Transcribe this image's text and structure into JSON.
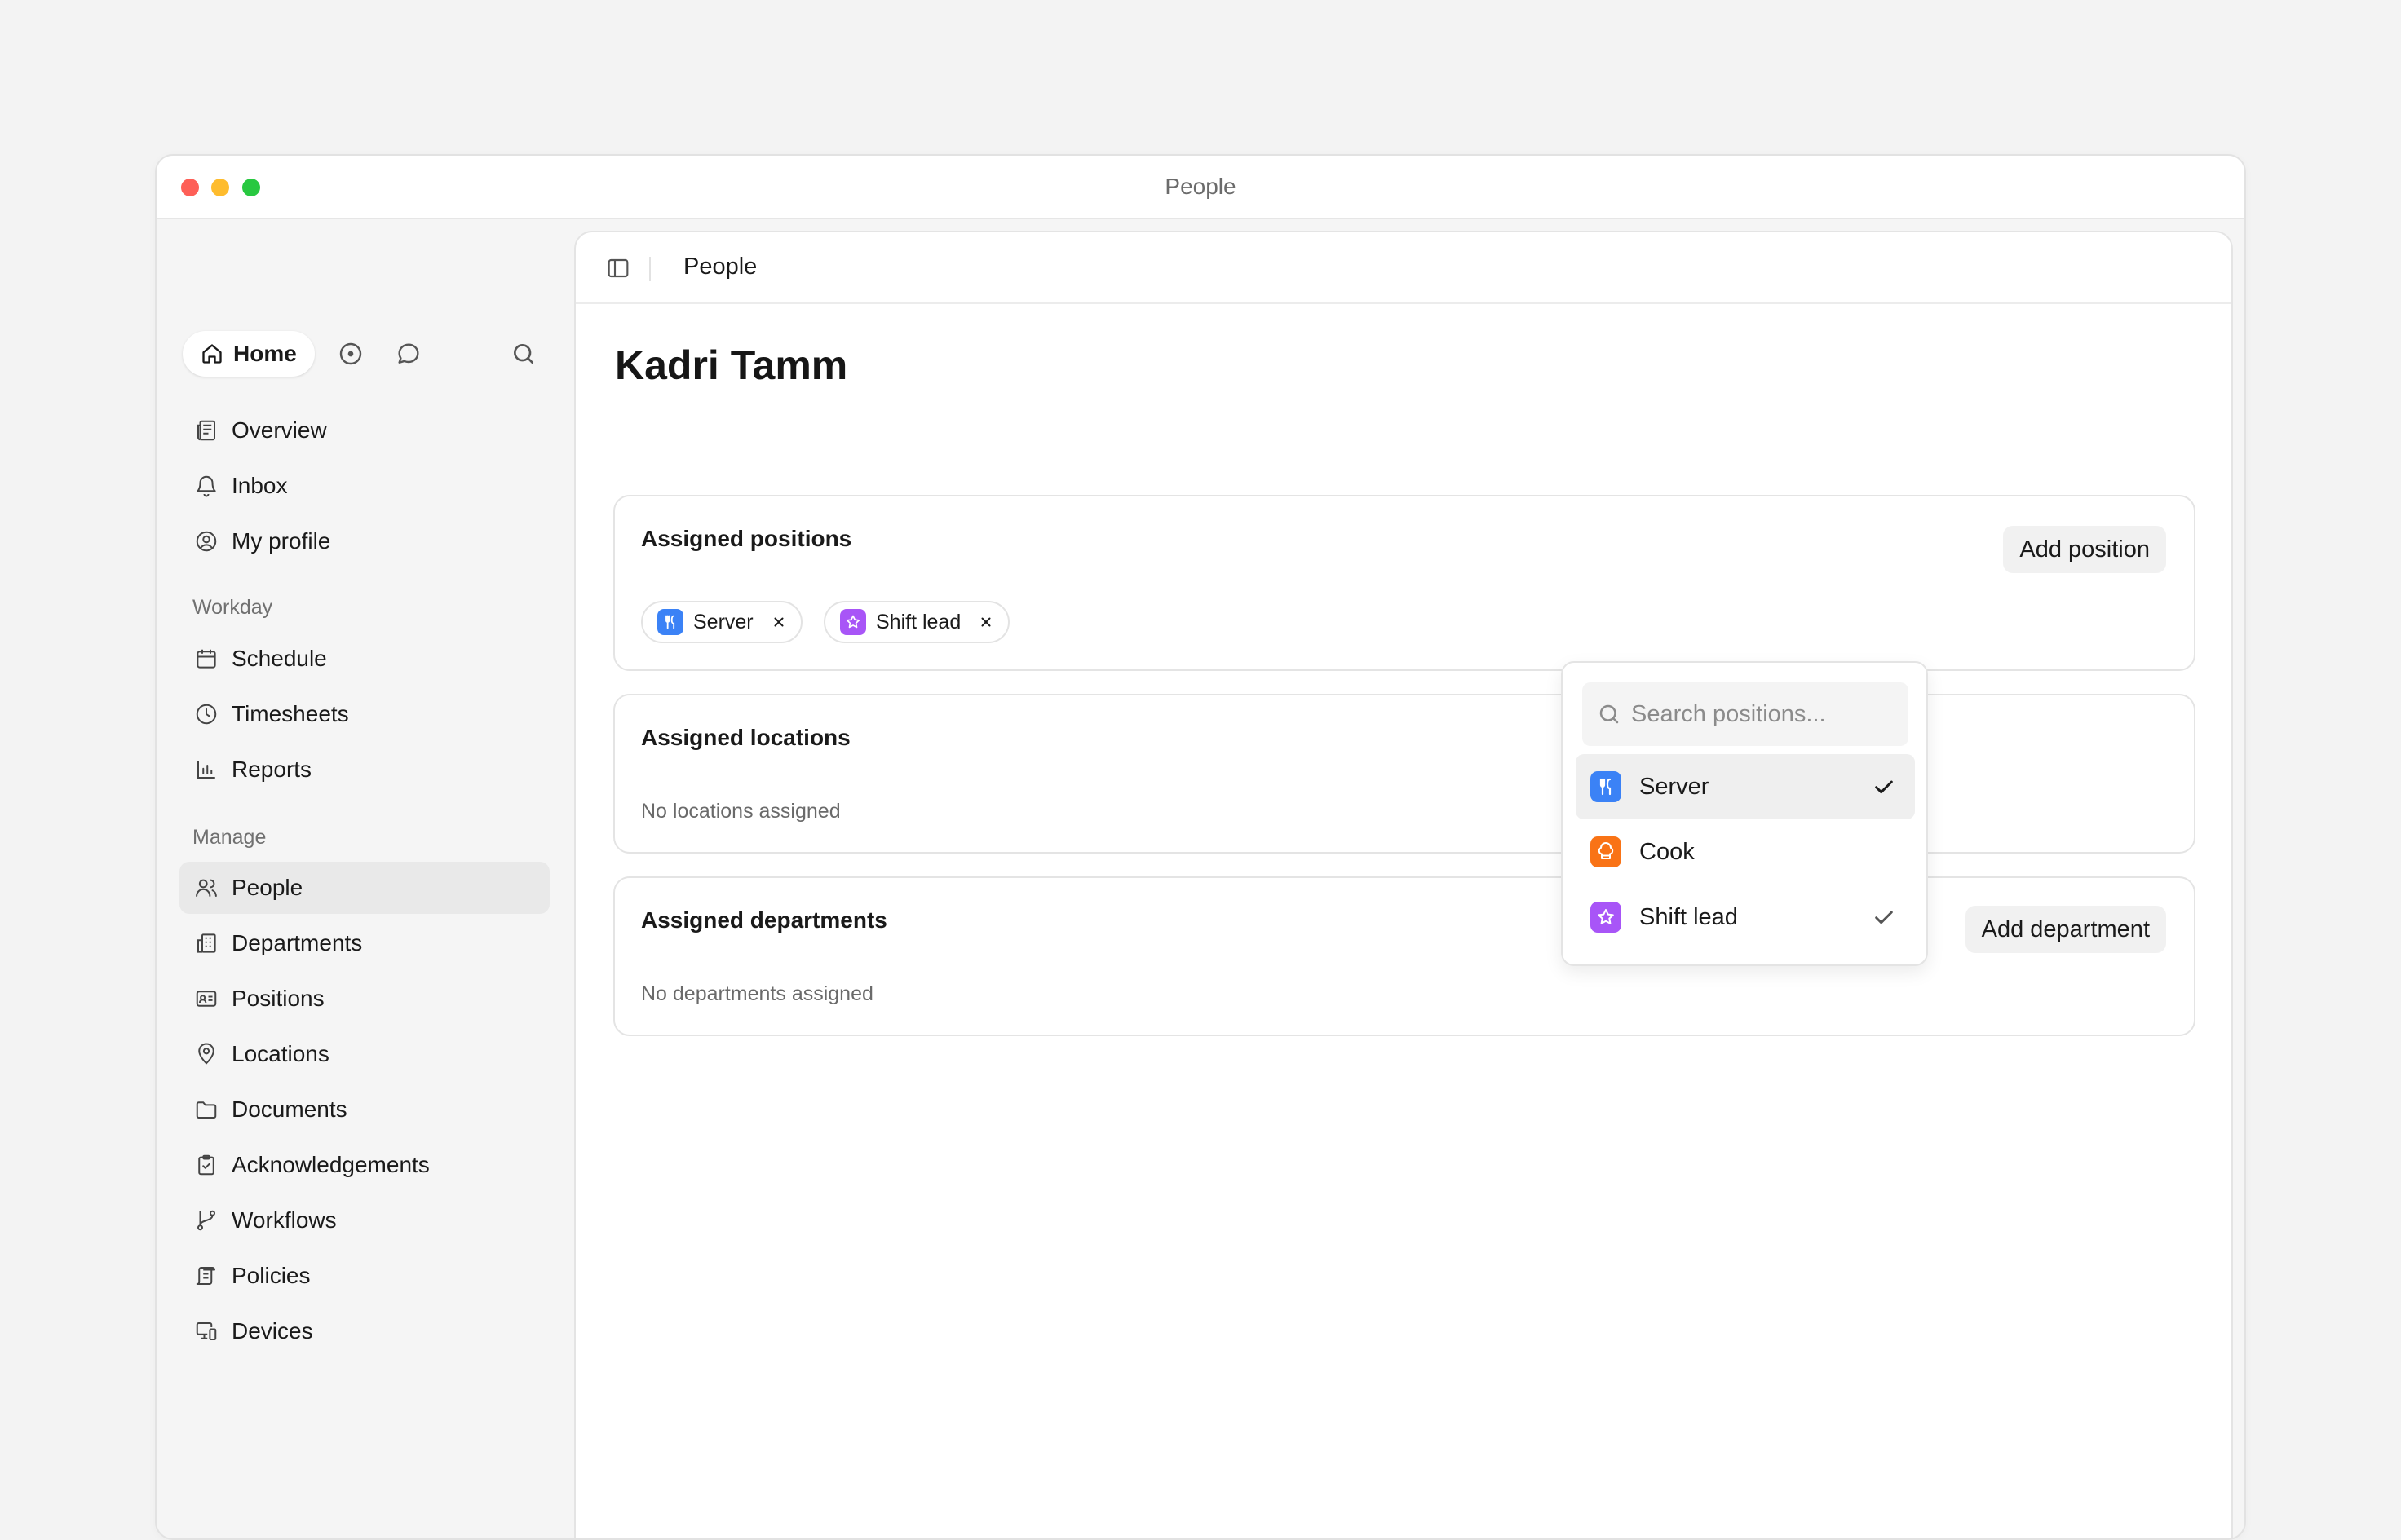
{
  "window": {
    "title": "People"
  },
  "sidebar": {
    "home_label": "Home",
    "primary": [
      {
        "label": "Overview",
        "icon": "newspaper-icon"
      },
      {
        "label": "Inbox",
        "icon": "bell-icon"
      },
      {
        "label": "My profile",
        "icon": "user-circle-icon"
      }
    ],
    "sections": [
      {
        "title": "Workday",
        "items": [
          {
            "label": "Schedule",
            "icon": "calendar-icon"
          },
          {
            "label": "Timesheets",
            "icon": "clock-icon"
          },
          {
            "label": "Reports",
            "icon": "bar-chart-icon"
          }
        ]
      },
      {
        "title": "Manage",
        "items": [
          {
            "label": "People",
            "icon": "users-icon",
            "active": true
          },
          {
            "label": "Departments",
            "icon": "building-icon"
          },
          {
            "label": "Positions",
            "icon": "id-card-icon"
          },
          {
            "label": "Locations",
            "icon": "map-pin-icon"
          },
          {
            "label": "Documents",
            "icon": "folder-icon"
          },
          {
            "label": "Acknowledgements",
            "icon": "clipboard-check-icon"
          },
          {
            "label": "Workflows",
            "icon": "git-branch-icon"
          },
          {
            "label": "Policies",
            "icon": "scroll-icon"
          },
          {
            "label": "Devices",
            "icon": "monitor-smartphone-icon"
          }
        ]
      }
    ]
  },
  "header": {
    "title": "People"
  },
  "person": {
    "name": "Kadri Tamm"
  },
  "positions_card": {
    "title": "Assigned positions",
    "add_label": "Add position",
    "chips": [
      {
        "label": "Server",
        "color": "#3b82f6",
        "icon": "utensils-icon"
      },
      {
        "label": "Shift lead",
        "color": "#a855f7",
        "icon": "star-icon"
      }
    ]
  },
  "locations_card": {
    "title": "Assigned locations",
    "empty": "No locations assigned"
  },
  "departments_card": {
    "title": "Assigned departments",
    "add_label": "Add department",
    "empty": "No departments assigned"
  },
  "dropdown": {
    "placeholder": "Search positions...",
    "options": [
      {
        "label": "Server",
        "color": "#3b82f6",
        "icon": "utensils-icon",
        "selected": true
      },
      {
        "label": "Cook",
        "color": "#f97316",
        "icon": "chef-hat-icon",
        "selected": false
      },
      {
        "label": "Shift lead",
        "color": "#a855f7",
        "icon": "star-icon",
        "selected": true
      }
    ]
  }
}
